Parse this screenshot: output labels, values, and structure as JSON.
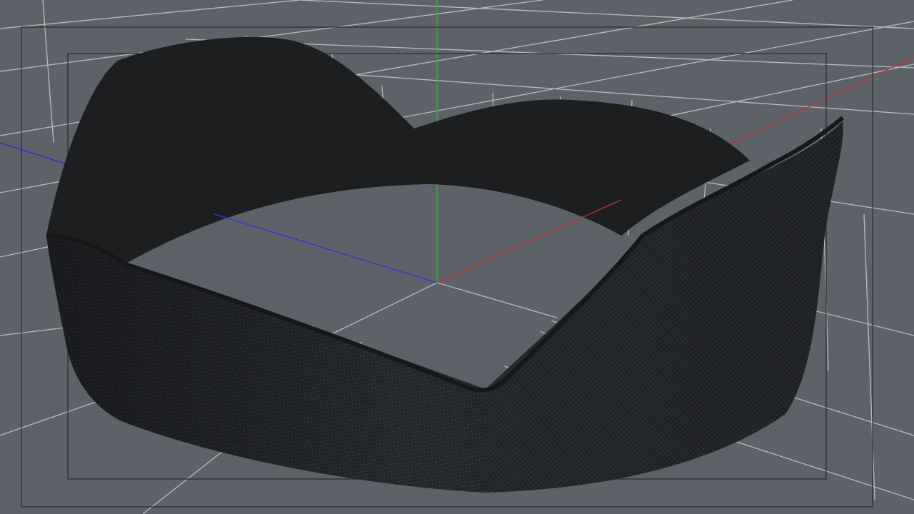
{
  "viewport": {
    "view": "perspective",
    "background_color": "#5d6268",
    "grid": {
      "visible": true,
      "color": "#c8ccd0"
    },
    "axes": {
      "x_color": "#c83232",
      "y_color": "#2fb52f",
      "z_color": "#2a2ad8"
    },
    "safe_frames": {
      "visible": true,
      "color": "#2c2f33"
    },
    "model": {
      "name": "lens-hood",
      "display": "wireframe-on-shaded",
      "shaded_color": "#1d1e20",
      "wire_color": "#3b4048"
    }
  }
}
